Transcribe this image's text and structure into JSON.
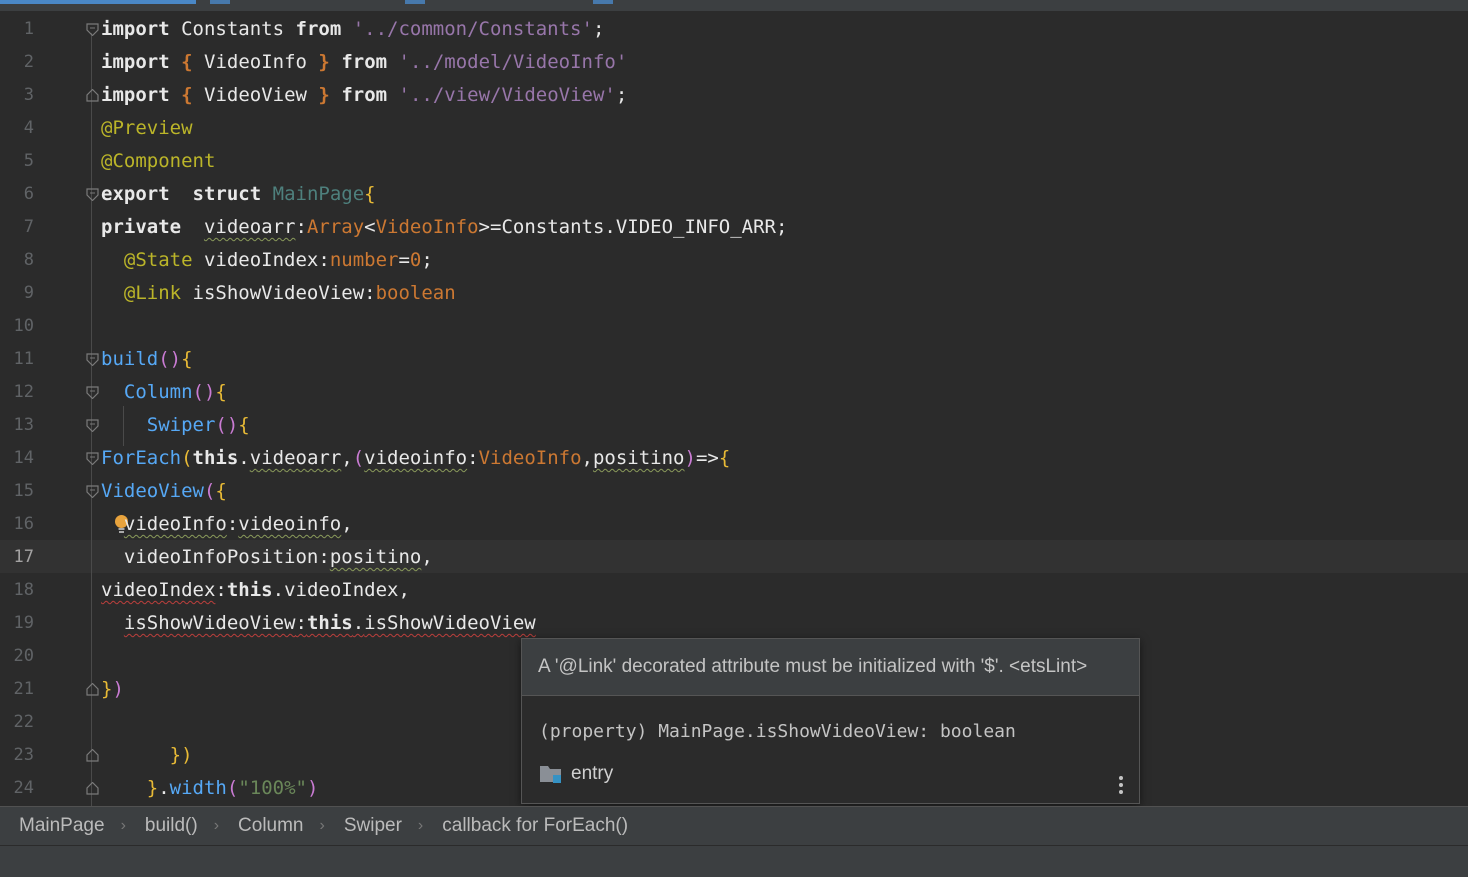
{
  "editor": {
    "current_line": "17",
    "lines": [
      {
        "n": "1"
      },
      {
        "n": "2"
      },
      {
        "n": "3"
      },
      {
        "n": "4"
      },
      {
        "n": "5"
      },
      {
        "n": "6"
      },
      {
        "n": "7"
      },
      {
        "n": "8"
      },
      {
        "n": "9"
      },
      {
        "n": "10"
      },
      {
        "n": "11"
      },
      {
        "n": "12"
      },
      {
        "n": "13"
      },
      {
        "n": "14"
      },
      {
        "n": "15"
      },
      {
        "n": "16"
      },
      {
        "n": "17"
      },
      {
        "n": "18"
      },
      {
        "n": "19"
      },
      {
        "n": "20"
      },
      {
        "n": "21"
      },
      {
        "n": "22"
      },
      {
        "n": "23"
      },
      {
        "n": "24"
      }
    ],
    "tokens": {
      "import": "import",
      "from": "from",
      "constants": "Constants",
      "constants_path": "'../common/Constants'",
      "semicolon": ";",
      "open_brace": "{",
      "close_brace": "}",
      "videoinfo_type": "VideoInfo",
      "videoinfo_path": "'../model/VideoInfo'",
      "videoview": "VideoView",
      "videoview_path": "'../view/VideoView'",
      "preview": "@Preview",
      "component": "@Component",
      "export": "export",
      "struct": "struct",
      "mainpage": "MainPage",
      "private": "private",
      "videoarr": "videoarr",
      "colon": ":",
      "array": "Array",
      "lt": "<",
      "gt_eq": ">=",
      "constants_arr": "Constants.VIDEO_INFO_ARR",
      "state": "@State",
      "videoindex": "videoIndex",
      "number": "number",
      "eq": "=",
      "zero": "0",
      "link": "@Link",
      "isshowvideoview": "isShowVideoView",
      "boolean": "boolean",
      "build": "build",
      "parens": "()",
      "column": "Column",
      "swiper": "Swiper",
      "foreach": "ForEach",
      "open_paren": "(",
      "close_paren": ")",
      "this": "this",
      "dot": ".",
      "comma": ",",
      "videoinfo_param": "videoinfo",
      "positino": "positino",
      "arrow": "=>",
      "videoinfo_key": "videoInfo",
      "videoinfo_position_key": "videoInfoPosition",
      "close_obj": "})",
      "width": "width",
      "width_val": "\"100%\""
    }
  },
  "popup": {
    "message": "A '@Link' decorated attribute must be initialized with '$'. <etsLint>",
    "signature": "(property) MainPage.isShowVideoView: boolean",
    "module": "entry",
    "module_icon": "folder-module-icon",
    "more_icon": "more-vert-icon"
  },
  "breadcrumbs": [
    "MainPage",
    "build()",
    "Column",
    "Swiper",
    "callback for ForEach()"
  ],
  "colors": {
    "background": "#2b2b2b",
    "keyword": "#cc7832",
    "string": "#6a8759",
    "annotation": "#bbb529",
    "number": "#6897bb",
    "error_underline": "#bc3f3c"
  }
}
